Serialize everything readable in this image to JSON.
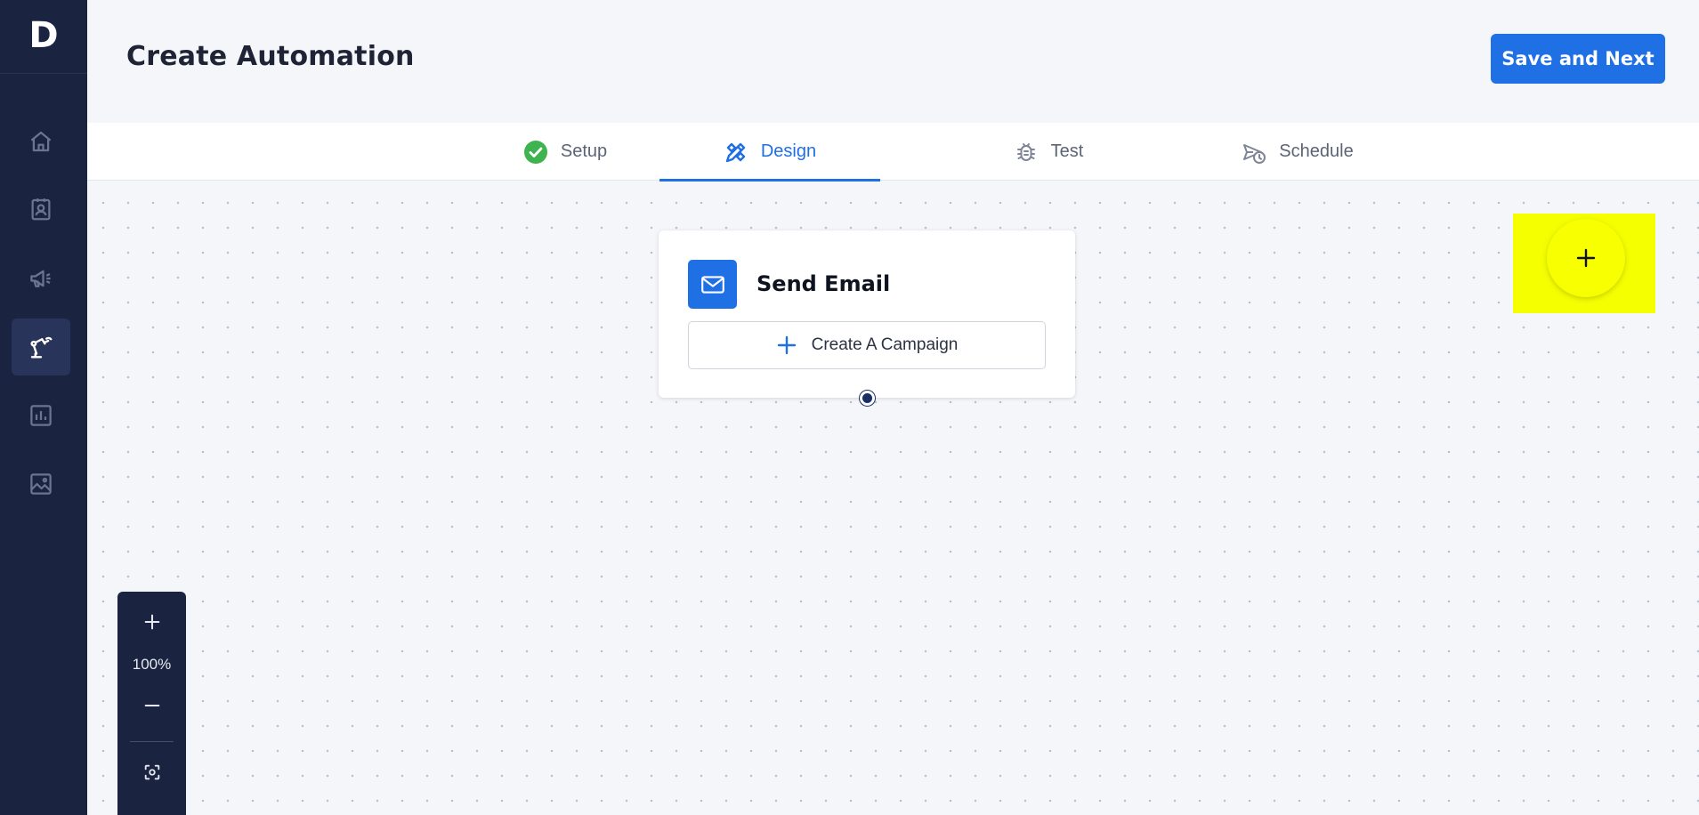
{
  "app": {
    "logo_letter": "D"
  },
  "sidebar": {
    "items": [
      {
        "name": "home",
        "icon": "home-icon",
        "active": false
      },
      {
        "name": "contacts",
        "icon": "contact-card-icon",
        "active": false
      },
      {
        "name": "campaigns",
        "icon": "megaphone-icon",
        "active": false
      },
      {
        "name": "automation",
        "icon": "robot-arm-icon",
        "active": true
      },
      {
        "name": "reports",
        "icon": "bar-chart-icon",
        "active": false
      },
      {
        "name": "media",
        "icon": "image-icon",
        "active": false
      }
    ]
  },
  "header": {
    "title": "Create Automation",
    "save_label": "Save and Next"
  },
  "tabs": [
    {
      "label": "Setup",
      "icon": "check-circle-icon",
      "active": false
    },
    {
      "label": "Design",
      "icon": "design-tools-icon",
      "active": true
    },
    {
      "label": "Test",
      "icon": "bug-icon",
      "active": false
    },
    {
      "label": "Schedule",
      "icon": "schedule-send-icon",
      "active": false
    }
  ],
  "canvas": {
    "node": {
      "title": "Send Email",
      "icon": "mail-icon",
      "action_label": "Create A Campaign"
    },
    "add_button": {
      "icon": "plus-icon"
    }
  },
  "zoom": {
    "level": "100%"
  },
  "colors": {
    "sidebar_bg": "#1a2340",
    "primary": "#1f6fe5",
    "success": "#3fb34f",
    "highlight": "#f5ff00"
  }
}
